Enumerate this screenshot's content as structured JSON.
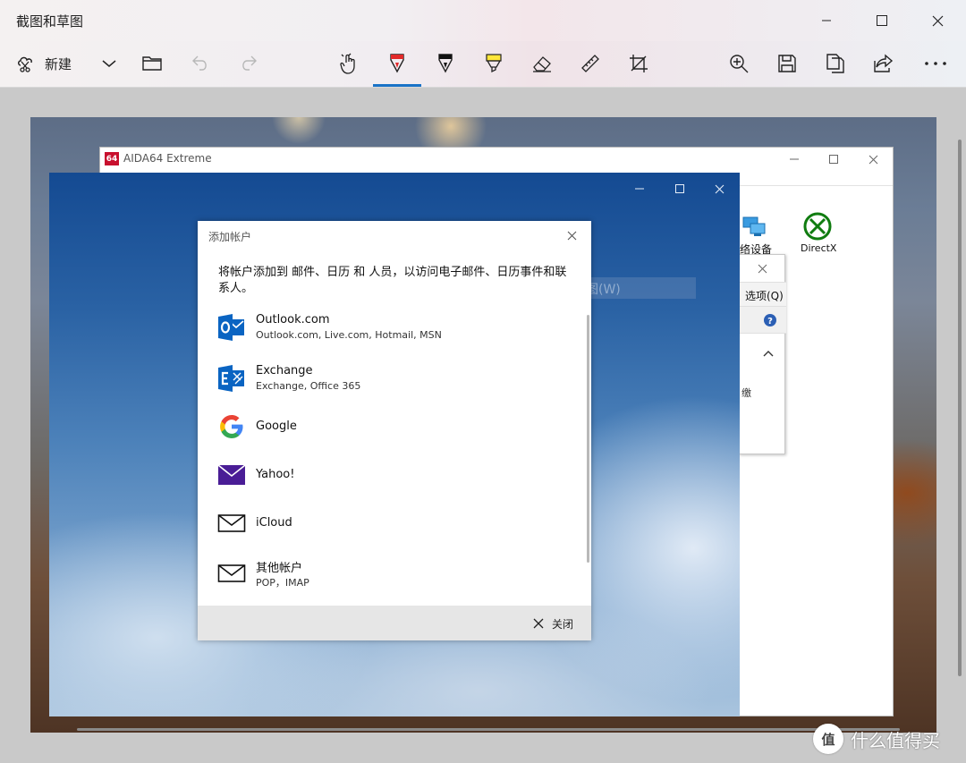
{
  "app": {
    "title": "截图和草图",
    "toolbar": {
      "new_label": "新建"
    }
  },
  "aida": {
    "title": "AIDA64 Extreme",
    "logo_text": "64",
    "icons": [
      {
        "label": "络设备",
        "icon": "network-icon"
      },
      {
        "label": "DirectX",
        "icon": "xbox-icon"
      }
    ],
    "inner_dialog": {
      "options_label": "选项(Q)",
      "stray_char": "缴"
    }
  },
  "mail": {
    "tooltip_text": "窗口截图(W)"
  },
  "dialog": {
    "title": "添加帐户",
    "description": "将帐户添加到 邮件、日历 和 人员，以访问电子邮件、日历事件和联系人。",
    "accounts": [
      {
        "name": "Outlook.com",
        "subtitle": "Outlook.com, Live.com, Hotmail, MSN",
        "icon": "outlook-icon"
      },
      {
        "name": "Exchange",
        "subtitle": "Exchange, Office 365",
        "icon": "exchange-icon"
      },
      {
        "name": "Google",
        "subtitle": "",
        "icon": "google-icon"
      },
      {
        "name": "Yahoo!",
        "subtitle": "",
        "icon": "yahoo-icon"
      },
      {
        "name": "iCloud",
        "subtitle": "",
        "icon": "mail-envelope-icon"
      },
      {
        "name": "其他帐户",
        "subtitle": "POP，IMAP",
        "icon": "mail-envelope-icon"
      }
    ],
    "close_label": "关闭"
  },
  "colors": {
    "accent": "#1a73c7",
    "outlook_blue": "#0a64c2",
    "yahoo_purple": "#4a1d96",
    "xbox_green": "#107c10"
  },
  "watermark": {
    "logo_text": "值",
    "text": "什么值得买"
  }
}
